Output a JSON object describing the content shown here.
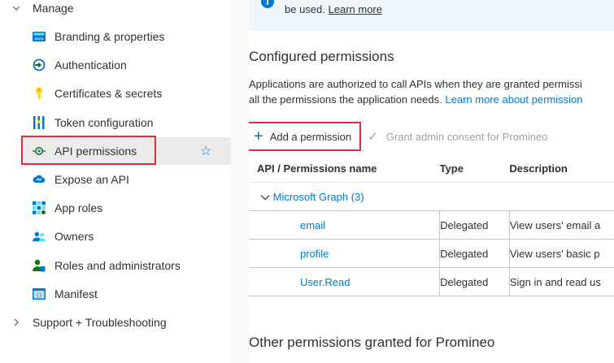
{
  "sidebar": {
    "manage_label": "Manage",
    "items": [
      {
        "label": "Branding & properties",
        "icon": "branding-icon"
      },
      {
        "label": "Authentication",
        "icon": "authentication-icon"
      },
      {
        "label": "Certificates & secrets",
        "icon": "key-icon"
      },
      {
        "label": "Token configuration",
        "icon": "token-icon"
      },
      {
        "label": "API permissions",
        "icon": "api-permissions-icon",
        "selected": true
      },
      {
        "label": "Expose an API",
        "icon": "cloud-api-icon"
      },
      {
        "label": "App roles",
        "icon": "app-roles-icon"
      },
      {
        "label": "Owners",
        "icon": "owners-icon"
      },
      {
        "label": "Roles and administrators",
        "icon": "roles-admins-icon"
      },
      {
        "label": "Manifest",
        "icon": "manifest-icon"
      }
    ],
    "support_label": "Support + Troubleshooting"
  },
  "banner": {
    "text": "be used.",
    "link": "Learn more"
  },
  "configured": {
    "title": "Configured permissions",
    "desc_line1": "Applications are authorized to call APIs when they are granted permissi",
    "desc_line2": "all the permissions the application needs.",
    "desc_link": "Learn more about permission"
  },
  "toolbar": {
    "add_label": "Add a permission",
    "grant_label": "Grant admin consent for Promineo"
  },
  "table": {
    "headers": [
      "API / Permissions name",
      "Type",
      "Description"
    ],
    "group": "Microsoft Graph (3)",
    "rows": [
      {
        "name": "email",
        "type": "Delegated",
        "description": "View users' email a"
      },
      {
        "name": "profile",
        "type": "Delegated",
        "description": "View users' basic p"
      },
      {
        "name": "User.Read",
        "type": "Delegated",
        "description": "Sign in and read us"
      }
    ]
  },
  "other": {
    "title": "Other permissions granted for Promineo"
  },
  "colors": {
    "accent": "#0078d4",
    "highlight": "#d13438"
  }
}
